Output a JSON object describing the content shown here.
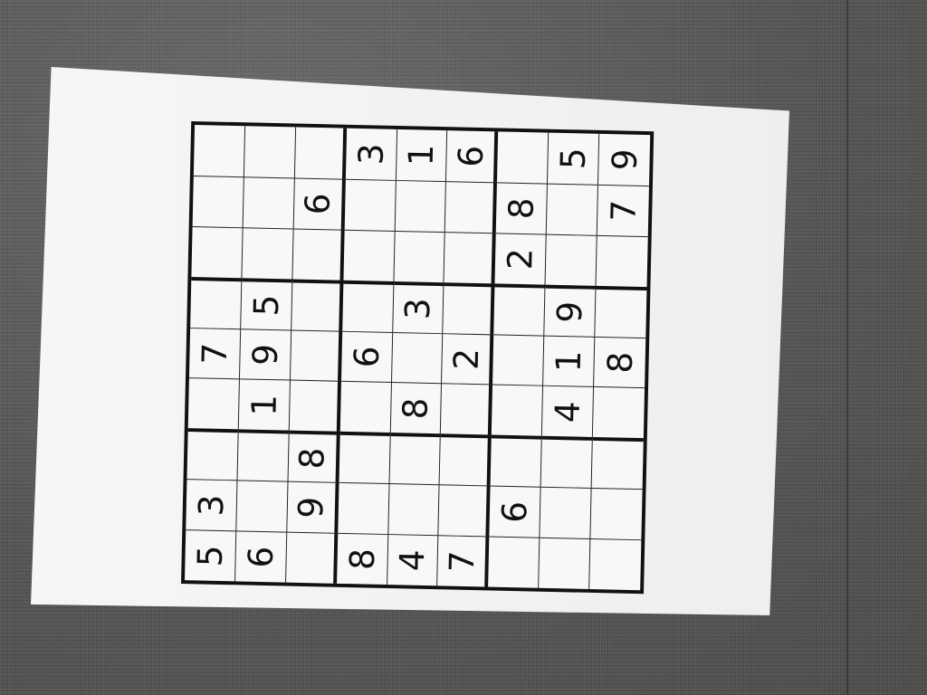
{
  "puzzle": {
    "grid": [
      [
        "5",
        "3",
        "",
        "",
        "7",
        "",
        "",
        "",
        ""
      ],
      [
        "6",
        "",
        "",
        "1",
        "9",
        "5",
        "",
        "",
        ""
      ],
      [
        "",
        "9",
        "8",
        "",
        "",
        "",
        "",
        "6",
        ""
      ],
      [
        "8",
        "",
        "",
        "",
        "6",
        "",
        "",
        "",
        "3"
      ],
      [
        "4",
        "",
        "",
        "8",
        "",
        "3",
        "",
        "",
        "1"
      ],
      [
        "7",
        "",
        "",
        "",
        "2",
        "",
        "",
        "",
        "6"
      ],
      [
        "",
        "6",
        "",
        "",
        "",
        "",
        "2",
        "8",
        ""
      ],
      [
        "",
        "",
        "",
        "4",
        "1",
        "9",
        "",
        "",
        "5"
      ],
      [
        "",
        "",
        "",
        "",
        "8",
        "",
        "",
        "7",
        "9"
      ]
    ]
  }
}
